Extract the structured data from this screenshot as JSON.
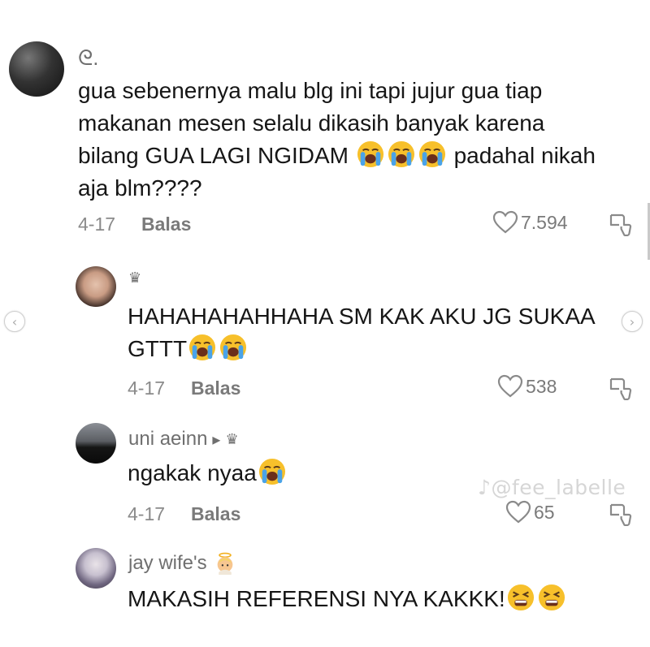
{
  "comments": [
    {
      "username": "ᘓ.",
      "lines": [
        "gua sebenernya malu blg ini tapi jujur gua tiap",
        "makanan mesen selalu dikasih banyak karena",
        "bilang GUA LAGI NGIDAM",
        "padahal nikah",
        "aja blm????"
      ],
      "date": "4-17",
      "reply_label": "Balas",
      "likes": "7.594"
    },
    {
      "username_badge": "♛",
      "lines": [
        "HAHAHAHAHHAHA SM KAK AKU JG SUKAA",
        "GTTT"
      ],
      "date": "4-17",
      "reply_label": "Balas",
      "likes": "538"
    },
    {
      "username": "uni aeinn",
      "reply_to_icon": "▸",
      "badge": "♛",
      "lines": [
        "ngakak nyaa"
      ],
      "date": "4-17",
      "reply_label": "Balas",
      "likes": "65"
    },
    {
      "username": "jay wife's",
      "lines": [
        "MAKASIH REFERENSI NYA KAKKK!"
      ]
    }
  ],
  "watermark": "♪@fee_labelle",
  "icons": {
    "like": "heart-outline-icon",
    "dislike": "thumb-down-icon",
    "emoji_cry": "loudly-crying-face-emoji",
    "emoji_tired": "tired-face-emoji",
    "emoji_angel": "baby-angel-emoji"
  },
  "colors": {
    "emoji_yellow": "#f7c02b",
    "tear_blue": "#4aa3e8",
    "muted_text": "#8a8a8a"
  }
}
